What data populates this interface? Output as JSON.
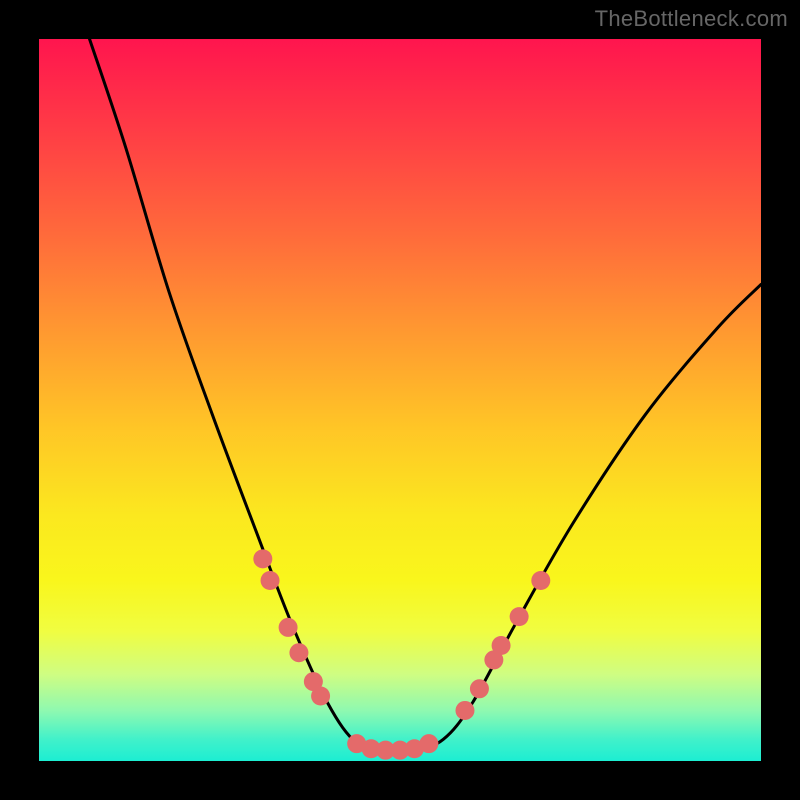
{
  "watermark": "TheBottleneck.com",
  "chart_data": {
    "type": "line",
    "title": "",
    "xlabel": "",
    "ylabel": "",
    "xlim": [
      0,
      100
    ],
    "ylim": [
      0,
      100
    ],
    "curve": {
      "name": "bottleneck-curve",
      "color": "#000000",
      "points": [
        {
          "x": 7,
          "y": 100
        },
        {
          "x": 12,
          "y": 85
        },
        {
          "x": 18,
          "y": 65
        },
        {
          "x": 24,
          "y": 48
        },
        {
          "x": 30,
          "y": 32
        },
        {
          "x": 35,
          "y": 19
        },
        {
          "x": 40,
          "y": 8
        },
        {
          "x": 44,
          "y": 2.5
        },
        {
          "x": 48,
          "y": 1.5
        },
        {
          "x": 52,
          "y": 1.5
        },
        {
          "x": 56,
          "y": 3
        },
        {
          "x": 60,
          "y": 8
        },
        {
          "x": 66,
          "y": 19
        },
        {
          "x": 74,
          "y": 33
        },
        {
          "x": 84,
          "y": 48
        },
        {
          "x": 94,
          "y": 60
        },
        {
          "x": 100,
          "y": 66
        }
      ]
    },
    "markers": {
      "name": "data-points",
      "color": "#e46a6a",
      "radius": 9.5,
      "points": [
        {
          "x": 31,
          "y": 28
        },
        {
          "x": 32,
          "y": 25
        },
        {
          "x": 34.5,
          "y": 18.5
        },
        {
          "x": 36,
          "y": 15
        },
        {
          "x": 38,
          "y": 11
        },
        {
          "x": 39,
          "y": 9
        },
        {
          "x": 44,
          "y": 2.4
        },
        {
          "x": 46,
          "y": 1.7
        },
        {
          "x": 48,
          "y": 1.5
        },
        {
          "x": 50,
          "y": 1.5
        },
        {
          "x": 52,
          "y": 1.7
        },
        {
          "x": 54,
          "y": 2.4
        },
        {
          "x": 59,
          "y": 7
        },
        {
          "x": 61,
          "y": 10
        },
        {
          "x": 63,
          "y": 14
        },
        {
          "x": 64,
          "y": 16
        },
        {
          "x": 66.5,
          "y": 20
        },
        {
          "x": 69.5,
          "y": 25
        }
      ]
    }
  }
}
